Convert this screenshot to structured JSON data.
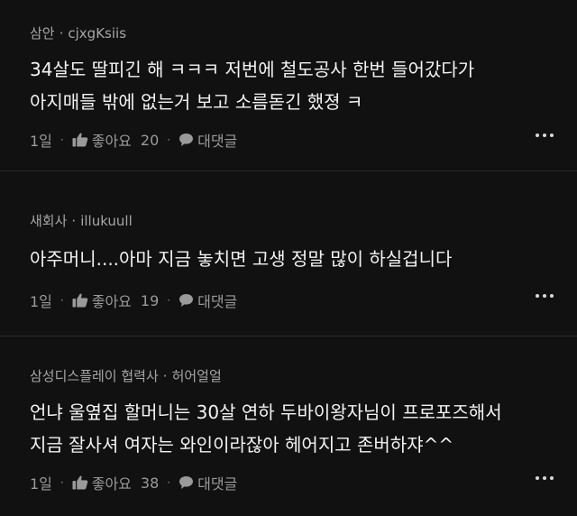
{
  "comments": [
    {
      "author_company": "삼안",
      "author_name": "cjxgKsiis",
      "lines": [
        "34살도 딸피긴 해 ㅋㅋㅋ 저번에 철도공사 한번 들어갔다가",
        "아지매들 밖에 없는거 보고 소름돋긴 했졍 ㅋ"
      ],
      "age": "1일",
      "like_label": "좋아요",
      "like_count": "20",
      "reply_label": "대댓글"
    },
    {
      "author_company": "새회사",
      "author_name": "illukuull",
      "lines": [
        "아주머니....아마 지금 놓치면 고생 정말 많이 하실겁니다"
      ],
      "age": "1일",
      "like_label": "좋아요",
      "like_count": "19",
      "reply_label": "대댓글"
    },
    {
      "author_company": "삼성디스플레이 협력사",
      "author_name": "허어얼얼",
      "lines": [
        "언냐 울옆집 할머니는 30살 연하 두바이왕자님이 프로포즈해서",
        "지금 잘사셔 여자는 와인이라잖아 헤어지고 존버하쟈^^"
      ],
      "age": "1일",
      "like_label": "좋아요",
      "like_count": "38",
      "reply_label": "대댓글"
    }
  ],
  "separator": "·",
  "icons": {
    "like": "thumbs-up-icon",
    "reply": "speech-bubble-icon",
    "more": "more-horizontal-icon"
  }
}
